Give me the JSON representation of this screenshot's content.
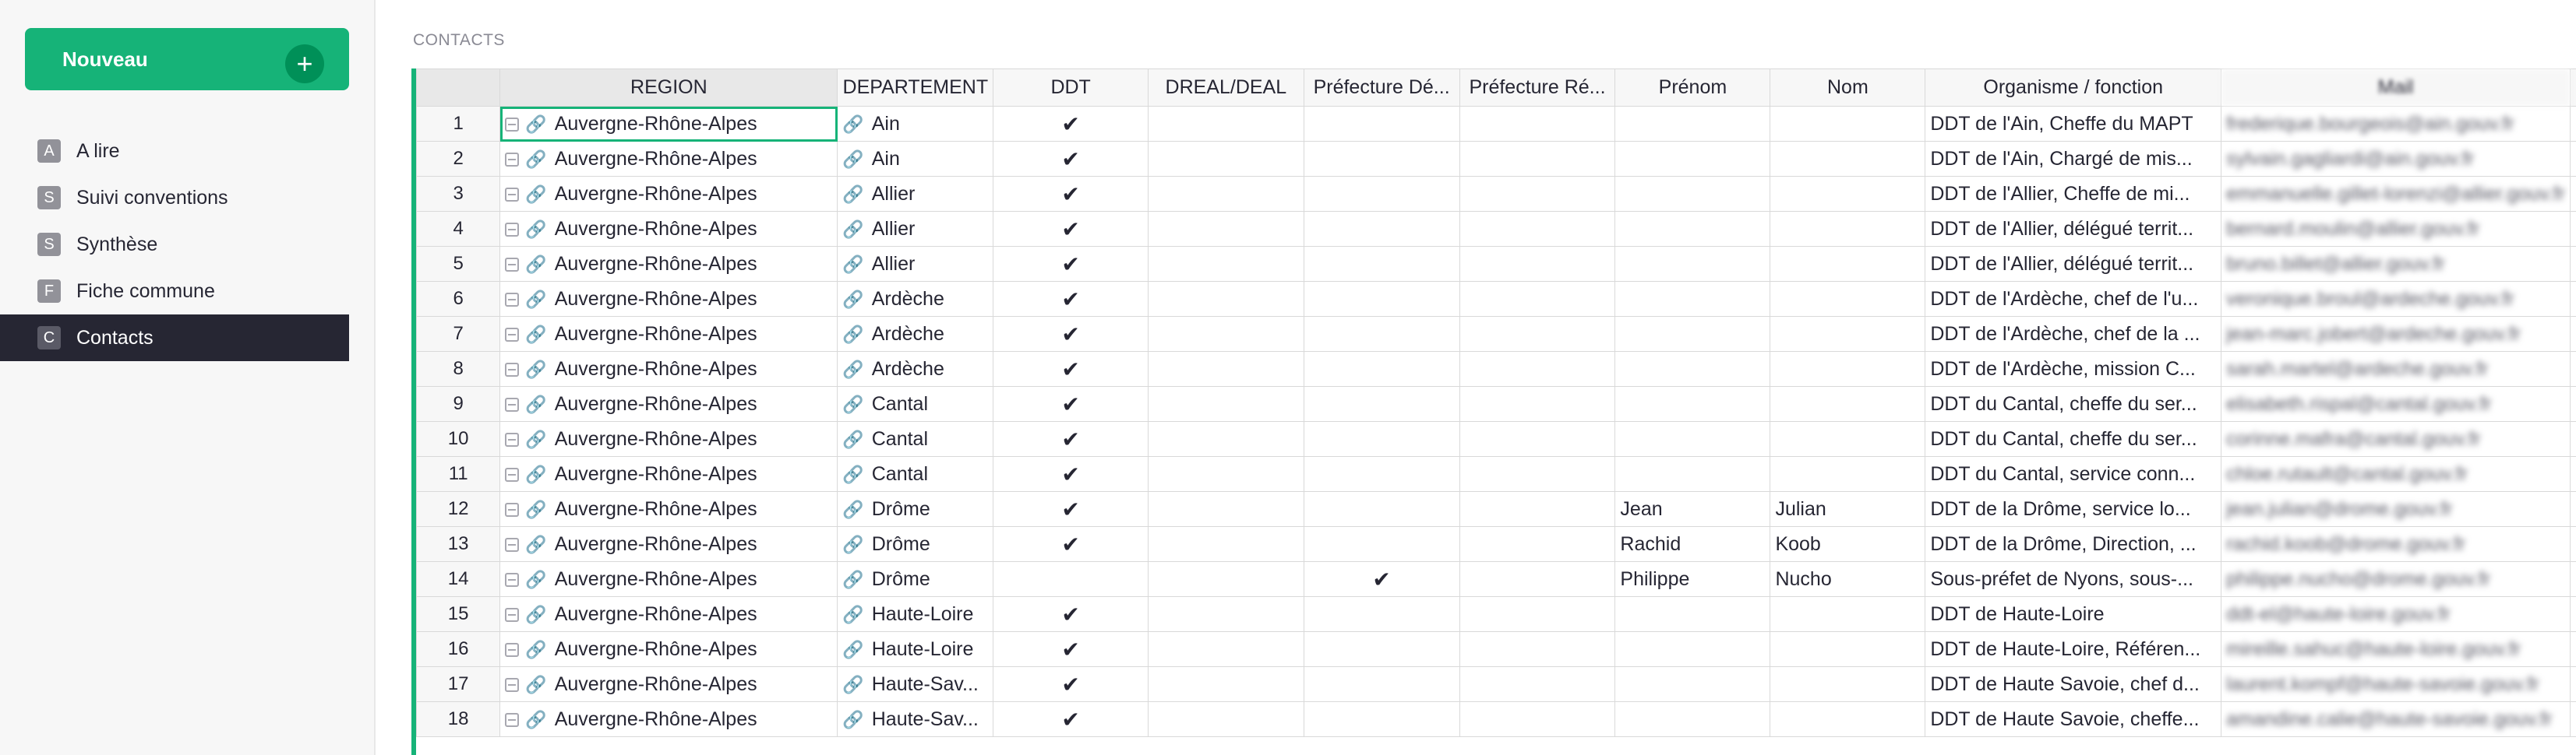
{
  "sidebar": {
    "new_label": "Nouveau",
    "plus_glyph": "+",
    "items": [
      {
        "badge": "A",
        "label": "A lire",
        "active": false
      },
      {
        "badge": "S",
        "label": "Suivi conventions",
        "active": false
      },
      {
        "badge": "S",
        "label": "Synthèse",
        "active": false
      },
      {
        "badge": "F",
        "label": "Fiche commune",
        "active": false
      },
      {
        "badge": "C",
        "label": "Contacts",
        "active": true
      }
    ]
  },
  "section_title": "CONTACTS",
  "colors": {
    "accent": "#16b378",
    "accent_dark": "#009058",
    "active_nav": "#262633"
  },
  "icons": {
    "ref": "reference-list-icon",
    "link": "link-icon",
    "check": "checkmark-icon"
  },
  "check_glyph": "✔",
  "link_glyph": "🔗",
  "columns": [
    "REGION",
    "DEPARTEMENT",
    "DDT",
    "DREAL/DEAL",
    "Préfecture Dé...",
    "Préfecture Ré...",
    "Prénom",
    "Nom",
    "Organisme / fonction",
    "Mail"
  ],
  "rows": [
    {
      "n": "1",
      "region": "Auvergne-Rhône-Alpes",
      "dept": "Ain",
      "ddt": true,
      "pref_dep": false,
      "prenom": "",
      "nom": "",
      "org": "DDT de l'Ain, Cheffe du MAPT",
      "mail": "frederique.bourgeois@ain.gouv.fr"
    },
    {
      "n": "2",
      "region": "Auvergne-Rhône-Alpes",
      "dept": "Ain",
      "ddt": true,
      "pref_dep": false,
      "prenom": "",
      "nom": "",
      "org": "DDT de l'Ain, Chargé de mis...",
      "mail": "sylvain.gagliardi@ain.gouv.fr"
    },
    {
      "n": "3",
      "region": "Auvergne-Rhône-Alpes",
      "dept": "Allier",
      "ddt": true,
      "pref_dep": false,
      "prenom": "",
      "nom": "",
      "org": "DDT de l'Allier, Cheffe de mi...",
      "mail": "emmanuelle.gillet-lorenzi@allier.gouv.fr"
    },
    {
      "n": "4",
      "region": "Auvergne-Rhône-Alpes",
      "dept": "Allier",
      "ddt": true,
      "pref_dep": false,
      "prenom": "",
      "nom": "",
      "org": "DDT de l'Allier, délégué territ...",
      "mail": "bernard.moulin@allier.gouv.fr"
    },
    {
      "n": "5",
      "region": "Auvergne-Rhône-Alpes",
      "dept": "Allier",
      "ddt": true,
      "pref_dep": false,
      "prenom": "",
      "nom": "",
      "org": "DDT de l'Allier, délégué territ...",
      "mail": "bruno.billet@allier.gouv.fr"
    },
    {
      "n": "6",
      "region": "Auvergne-Rhône-Alpes",
      "dept": "Ardèche",
      "ddt": true,
      "pref_dep": false,
      "prenom": "",
      "nom": "",
      "org": "DDT de l'Ardèche, chef de l'u...",
      "mail": "veronique.broul@ardeche.gouv.fr"
    },
    {
      "n": "7",
      "region": "Auvergne-Rhône-Alpes",
      "dept": "Ardèche",
      "ddt": true,
      "pref_dep": false,
      "prenom": "",
      "nom": "",
      "org": "DDT de l'Ardèche, chef de la ...",
      "mail": "jean-marc.jobert@ardeche.gouv.fr"
    },
    {
      "n": "8",
      "region": "Auvergne-Rhône-Alpes",
      "dept": "Ardèche",
      "ddt": true,
      "pref_dep": false,
      "prenom": "",
      "nom": "",
      "org": "DDT de l'Ardèche, mission C...",
      "mail": "sarah.martel@ardeche.gouv.fr"
    },
    {
      "n": "9",
      "region": "Auvergne-Rhône-Alpes",
      "dept": "Cantal",
      "ddt": true,
      "pref_dep": false,
      "prenom": "",
      "nom": "",
      "org": "DDT du Cantal, cheffe du ser...",
      "mail": "elisabeth.rispal@cantal.gouv.fr"
    },
    {
      "n": "10",
      "region": "Auvergne-Rhône-Alpes",
      "dept": "Cantal",
      "ddt": true,
      "pref_dep": false,
      "prenom": "",
      "nom": "",
      "org": "DDT du Cantal, cheffe du ser...",
      "mail": "corinne.mafra@cantal.gouv.fr"
    },
    {
      "n": "11",
      "region": "Auvergne-Rhône-Alpes",
      "dept": "Cantal",
      "ddt": true,
      "pref_dep": false,
      "prenom": "",
      "nom": "",
      "org": "DDT du Cantal, service conn...",
      "mail": "chloe.rutault@cantal.gouv.fr"
    },
    {
      "n": "12",
      "region": "Auvergne-Rhône-Alpes",
      "dept": "Drôme",
      "ddt": true,
      "pref_dep": false,
      "prenom": "Jean",
      "nom": "Julian",
      "org": "DDT de la Drôme, service lo...",
      "mail": "jean.julian@drome.gouv.fr"
    },
    {
      "n": "13",
      "region": "Auvergne-Rhône-Alpes",
      "dept": "Drôme",
      "ddt": true,
      "pref_dep": false,
      "prenom": "Rachid",
      "nom": "Koob",
      "org": "DDT de la Drôme, Direction, ...",
      "mail": "rachid.koob@drome.gouv.fr"
    },
    {
      "n": "14",
      "region": "Auvergne-Rhône-Alpes",
      "dept": "Drôme",
      "ddt": false,
      "pref_dep": true,
      "prenom": "Philippe",
      "nom": "Nucho",
      "org": "Sous-préfet de Nyons, sous-...",
      "mail": "philippe.nucho@drome.gouv.fr"
    },
    {
      "n": "15",
      "region": "Auvergne-Rhône-Alpes",
      "dept": "Haute-Loire",
      "ddt": true,
      "pref_dep": false,
      "prenom": "",
      "nom": "",
      "org": "DDT de Haute-Loire",
      "mail": "ddt-el@haute-loire.gouv.fr"
    },
    {
      "n": "16",
      "region": "Auvergne-Rhône-Alpes",
      "dept": "Haute-Loire",
      "ddt": true,
      "pref_dep": false,
      "prenom": "",
      "nom": "",
      "org": "DDT de Haute-Loire, Référen...",
      "mail": "mireille.sahuc@haute-loire.gouv.fr"
    },
    {
      "n": "17",
      "region": "Auvergne-Rhône-Alpes",
      "dept": "Haute-Sav...",
      "ddt": true,
      "pref_dep": false,
      "prenom": "",
      "nom": "",
      "org": "DDT de Haute Savoie, chef d...",
      "mail": "laurent.kompf@haute-savoie.gouv.fr"
    },
    {
      "n": "18",
      "region": "Auvergne-Rhône-Alpes",
      "dept": "Haute-Sav...",
      "ddt": true,
      "pref_dep": false,
      "prenom": "",
      "nom": "",
      "org": "DDT de Haute Savoie, cheffe...",
      "mail": "amandine.calie@haute-savoie.gouv.fr"
    }
  ]
}
